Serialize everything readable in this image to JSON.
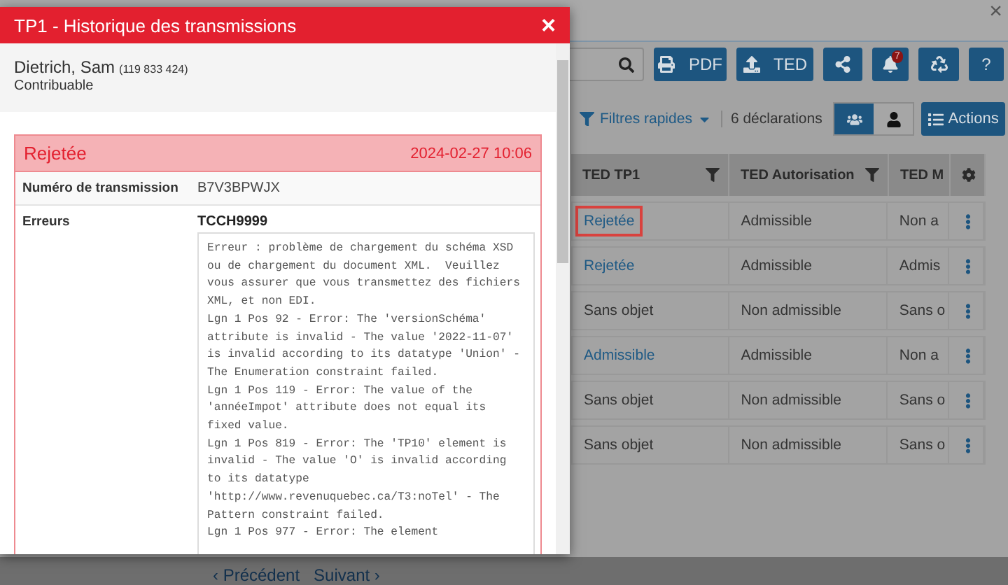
{
  "page": {
    "close": "×",
    "toolbar": [
      {
        "kind": "print",
        "label": "PDF"
      },
      {
        "kind": "upload",
        "label": "TED"
      },
      {
        "kind": "share"
      },
      {
        "kind": "bell",
        "badge": "7"
      },
      {
        "kind": "recycle"
      },
      {
        "kind": "help",
        "label": "?"
      }
    ],
    "filter": "Filtres rapides",
    "count": "6 déclarations",
    "views": [
      {
        "kind": "group",
        "selected": true
      },
      {
        "kind": "person",
        "selected": false
      }
    ],
    "actions": "Actions",
    "table": {
      "columns": [
        "TED TP1",
        "TED Autorisation",
        "TED M"
      ],
      "rows": [
        {
          "highlighted": true,
          "cells": [
            {
              "text": "Rejetée",
              "link": true
            },
            {
              "text": "Admissible",
              "link": false
            },
            {
              "text": "Non a",
              "link": false
            }
          ]
        },
        {
          "highlighted": false,
          "cells": [
            {
              "text": "Rejetée",
              "link": true
            },
            {
              "text": "Admissible",
              "link": false
            },
            {
              "text": "Admis",
              "link": false
            }
          ]
        },
        {
          "highlighted": false,
          "cells": [
            {
              "text": "Sans objet",
              "link": false
            },
            {
              "text": "Non admissible",
              "link": false
            },
            {
              "text": "Sans o",
              "link": false
            }
          ]
        },
        {
          "highlighted": false,
          "cells": [
            {
              "text": "Admissible",
              "link": true
            },
            {
              "text": "Admissible",
              "link": false
            },
            {
              "text": "Non a",
              "link": false
            }
          ]
        },
        {
          "highlighted": false,
          "cells": [
            {
              "text": "Sans objet",
              "link": false
            },
            {
              "text": "Non admissible",
              "link": false
            },
            {
              "text": "Sans o",
              "link": false
            }
          ]
        },
        {
          "highlighted": false,
          "cells": [
            {
              "text": "Sans objet",
              "link": false
            },
            {
              "text": "Non admissible",
              "link": false
            },
            {
              "text": "Sans o",
              "link": false
            }
          ]
        }
      ]
    },
    "pagination": {
      "previous": "‹ Précédent",
      "next": "Suivant ›"
    }
  },
  "dialog": {
    "title": "TP1 - Historique des transmissions",
    "close": "×",
    "person": {
      "name": "Dietrich, Sam",
      "id": "(119 833 424)",
      "role": "Contribuable"
    },
    "transmission": {
      "status": "Rejetée",
      "date": "2024-02-27 10:06",
      "fields": [
        {
          "label": "Numéro de transmission",
          "value": "B7V3BPWJX"
        }
      ],
      "errors": {
        "label": "Erreurs",
        "code": "TCCH9999",
        "messages": [
          "Erreur : problème de chargement du schéma XSD ou de chargement du document XML.  Veuillez vous assurer que vous transmettez des fichiers XML, et non EDI.",
          "Lgn 1 Pos 92 - Error: The 'versionSchéma' attribute is invalid - The value '2022-11-07' is invalid according to its datatype 'Union' - The Enumeration constraint failed.",
          "Lgn 1 Pos 119 - Error: The value of the 'annéeImpot' attribute does not equal its fixed value.",
          "Lgn 1 Pos 819 - Error: The 'TP10' element is invalid - The value 'O' is invalid according to its datatype 'http://www.revenuquebec.ca/T3:noTel' - The Pattern constraint failed.",
          "Lgn 1 Pos 977 - Error: The element"
        ]
      }
    }
  }
}
